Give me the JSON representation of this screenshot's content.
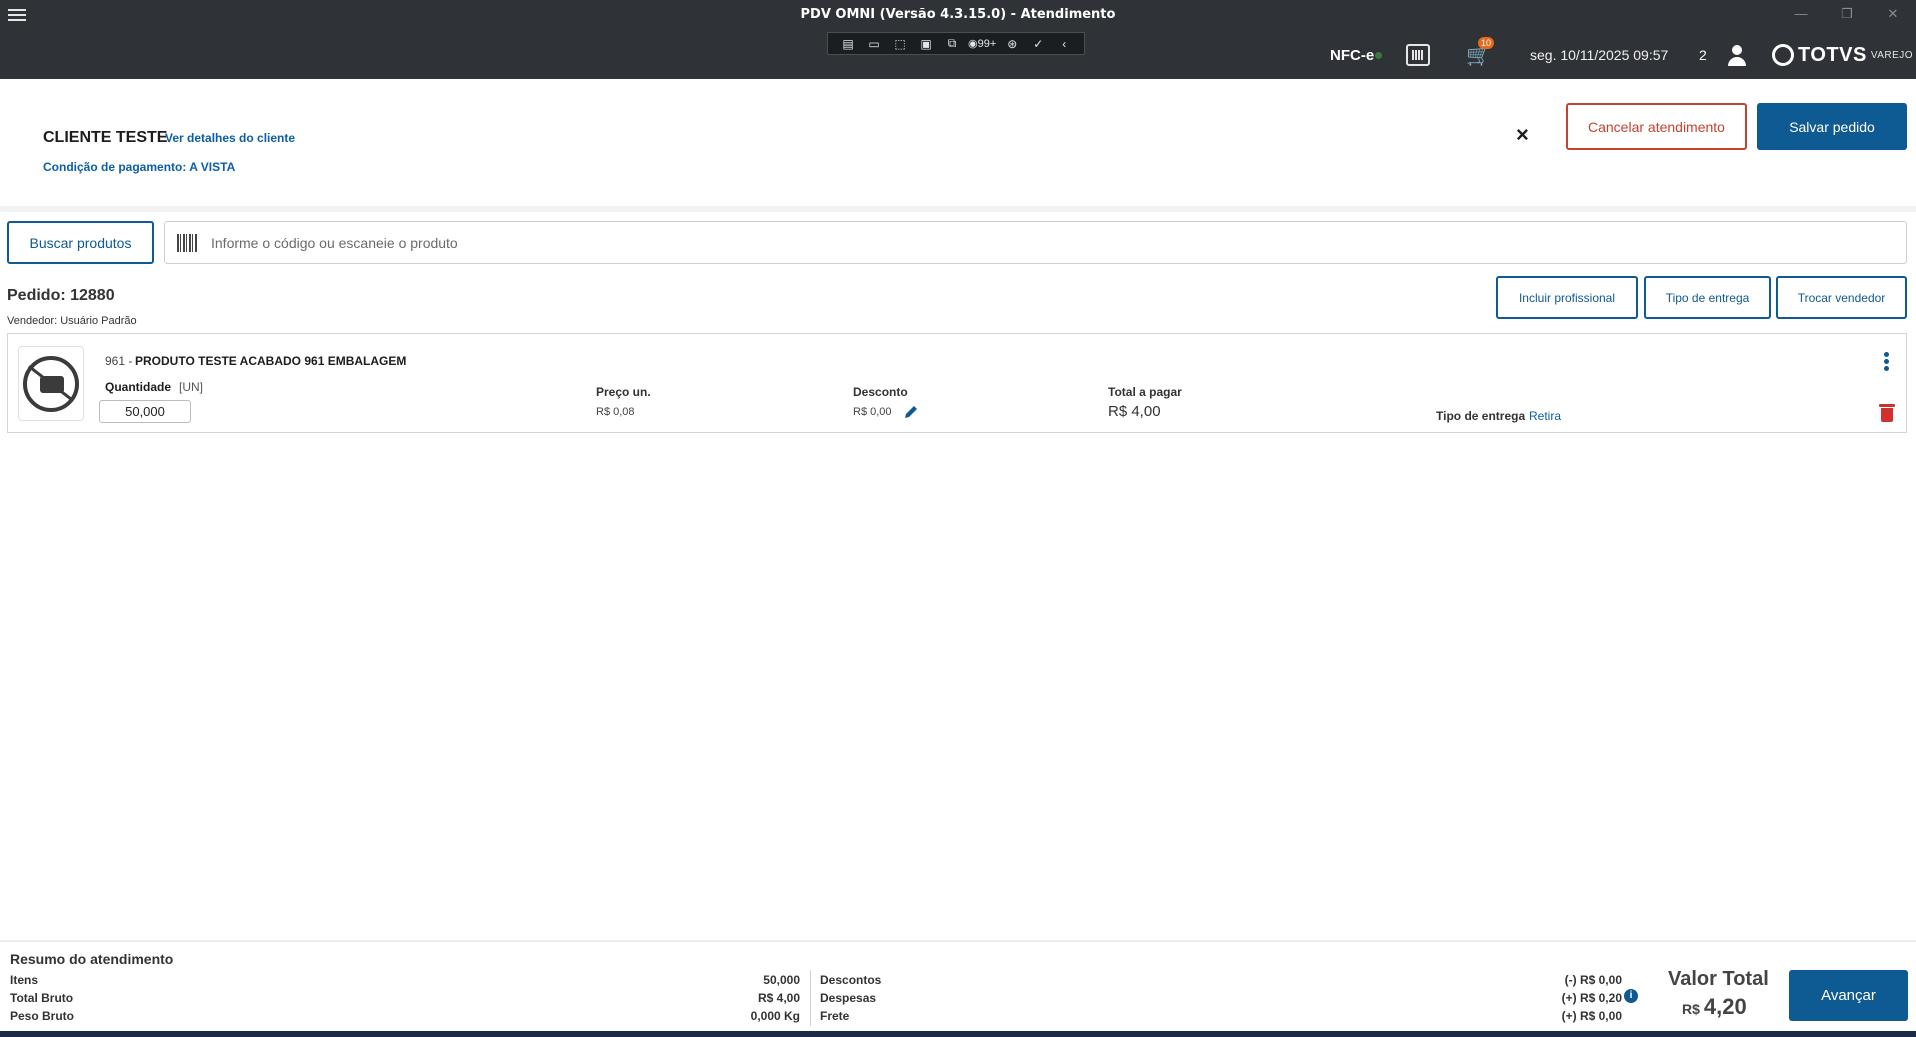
{
  "window": {
    "title": "PDV OMNI (Versão 4.3.15.0) - Atendimento",
    "minimize": "—",
    "maximize": "❐",
    "close": "✕"
  },
  "toolbar": {
    "notifications": "99+",
    "collapse": "‹"
  },
  "status": {
    "nfce": "NFC-e",
    "cart_count": "10",
    "datetime": "seg. 10/11/2025 09:57",
    "users_count": "2",
    "brand": "TOTVS",
    "brand_sub": "VAREJO"
  },
  "client": {
    "name": "CLIENTE TESTE",
    "details_link": "Ver detalhes do cliente",
    "payment_condition": "Condição de pagamento: A VISTA",
    "close": "×",
    "cancel_label": "Cancelar atendimento",
    "save_label": "Salvar pedido"
  },
  "search": {
    "button_label": "Buscar produtos",
    "placeholder": "Informe o código ou escaneie o produto",
    "value": ""
  },
  "order": {
    "number": "Pedido: 12880",
    "seller": "Vendedor: Usuário Padrão",
    "actions": {
      "include_professional": "Incluir profissional",
      "delivery_type": "Tipo de entrega",
      "change_seller": "Trocar vendedor"
    }
  },
  "item": {
    "code": "961 -",
    "name": "PRODUTO TESTE ACABADO 961 EMBALAGEM",
    "qty_label": "Quantidade",
    "unit": "[UN]",
    "qty_value": "50,000",
    "unit_price_label": "Preço un.",
    "unit_price": "R$ 0,08",
    "discount_label": "Desconto",
    "discount": "R$ 0,00",
    "total_label": "Total a pagar",
    "total": "R$ 4,00",
    "delivery_label": "Tipo de entrega",
    "delivery_value": "Retira"
  },
  "summary": {
    "title": "Resumo do atendimento",
    "items_label": "Itens",
    "items_value": "50,000",
    "gross_label": "Total Bruto",
    "gross_value": "R$ 4,00",
    "weight_label": "Peso Bruto",
    "weight_value": "0,000 Kg",
    "discounts_label": "Descontos",
    "discounts_value": "(-) R$ 0,00",
    "expenses_label": "Despesas",
    "expenses_value": "(+) R$ 0,20",
    "freight_label": "Frete",
    "freight_value": "(+) R$ 0,00",
    "total_label": "Valor Total",
    "total_currency": "R$",
    "total_value": "4,20",
    "next_label": "Avançar"
  },
  "colors": {
    "titlebar": "#2f3337",
    "primary": "#0e5a93",
    "danger": "#c2432f",
    "trash": "#d0312d",
    "badge": "#e46a1c"
  }
}
